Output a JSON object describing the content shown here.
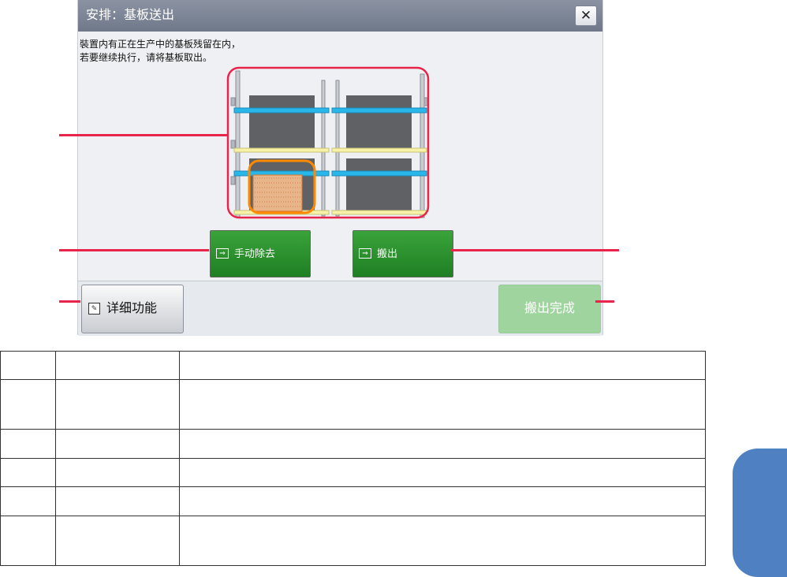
{
  "dialog": {
    "title": "安排：基板送出",
    "close_glyph": "✕",
    "message_line1": "裝置内有正在生产中的基板残留在内，",
    "message_line2": "若要继续执行，请将基板取出。",
    "buttons": {
      "manual_remove_label": "手动除去",
      "unload_label": "搬出",
      "detail_label": "详细功能",
      "unload_complete_label": "搬出完成"
    },
    "icons": [
      "transfer-icon",
      "detail-icon",
      "close-icon"
    ]
  },
  "colors": {
    "title_bar": "#7d8596",
    "green_button": "#2b9430",
    "disabled_green_button": "#9fd49f",
    "callout": "#e8244a",
    "side_tab": "#4f81c2",
    "rail_blue": "#29b6e8",
    "rail_yellow": "#f7f2a8",
    "highlight_orange": "#ff8a00"
  },
  "table": {
    "rows": [
      [
        "",
        "",
        ""
      ],
      [
        "",
        "",
        ""
      ],
      [
        "",
        "",
        ""
      ],
      [
        "",
        "",
        ""
      ],
      [
        "",
        "",
        ""
      ],
      [
        "",
        "",
        ""
      ]
    ]
  }
}
